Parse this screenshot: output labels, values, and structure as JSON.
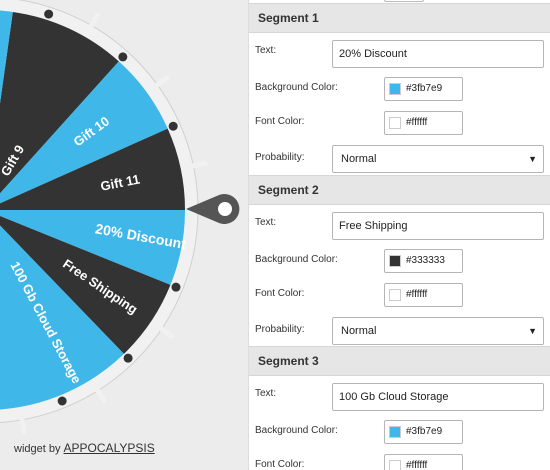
{
  "wheel": {
    "colors": {
      "blue": "#3fb7e9",
      "dark": "#333333",
      "rim": "#f1f1f1",
      "pointer": "#555555"
    },
    "labels": [
      "Gift 9",
      "Gift 10",
      "Gift 11",
      "20% Discount",
      "Free Shipping",
      "100 Gb Cloud Storage"
    ]
  },
  "credit": {
    "prefix": "widget by",
    "link": "APPOCALYPSIS"
  },
  "fields": {
    "text_label": "Text:",
    "bg_label": "Background Color:",
    "font_label": "Font Color:",
    "prob_label": "Probability:"
  },
  "segments": [
    {
      "title": "Segment 1",
      "text": "20% Discount",
      "bg": "#3fb7e9",
      "font": "#ffffff",
      "probability": "Normal"
    },
    {
      "title": "Segment 2",
      "text": "Free Shipping",
      "bg": "#333333",
      "font": "#ffffff",
      "probability": "Normal"
    },
    {
      "title": "Segment 3",
      "text": "100 Gb Cloud Storage",
      "bg": "#3fb7e9",
      "font": "#ffffff"
    }
  ],
  "dropdown_caret": "▼"
}
